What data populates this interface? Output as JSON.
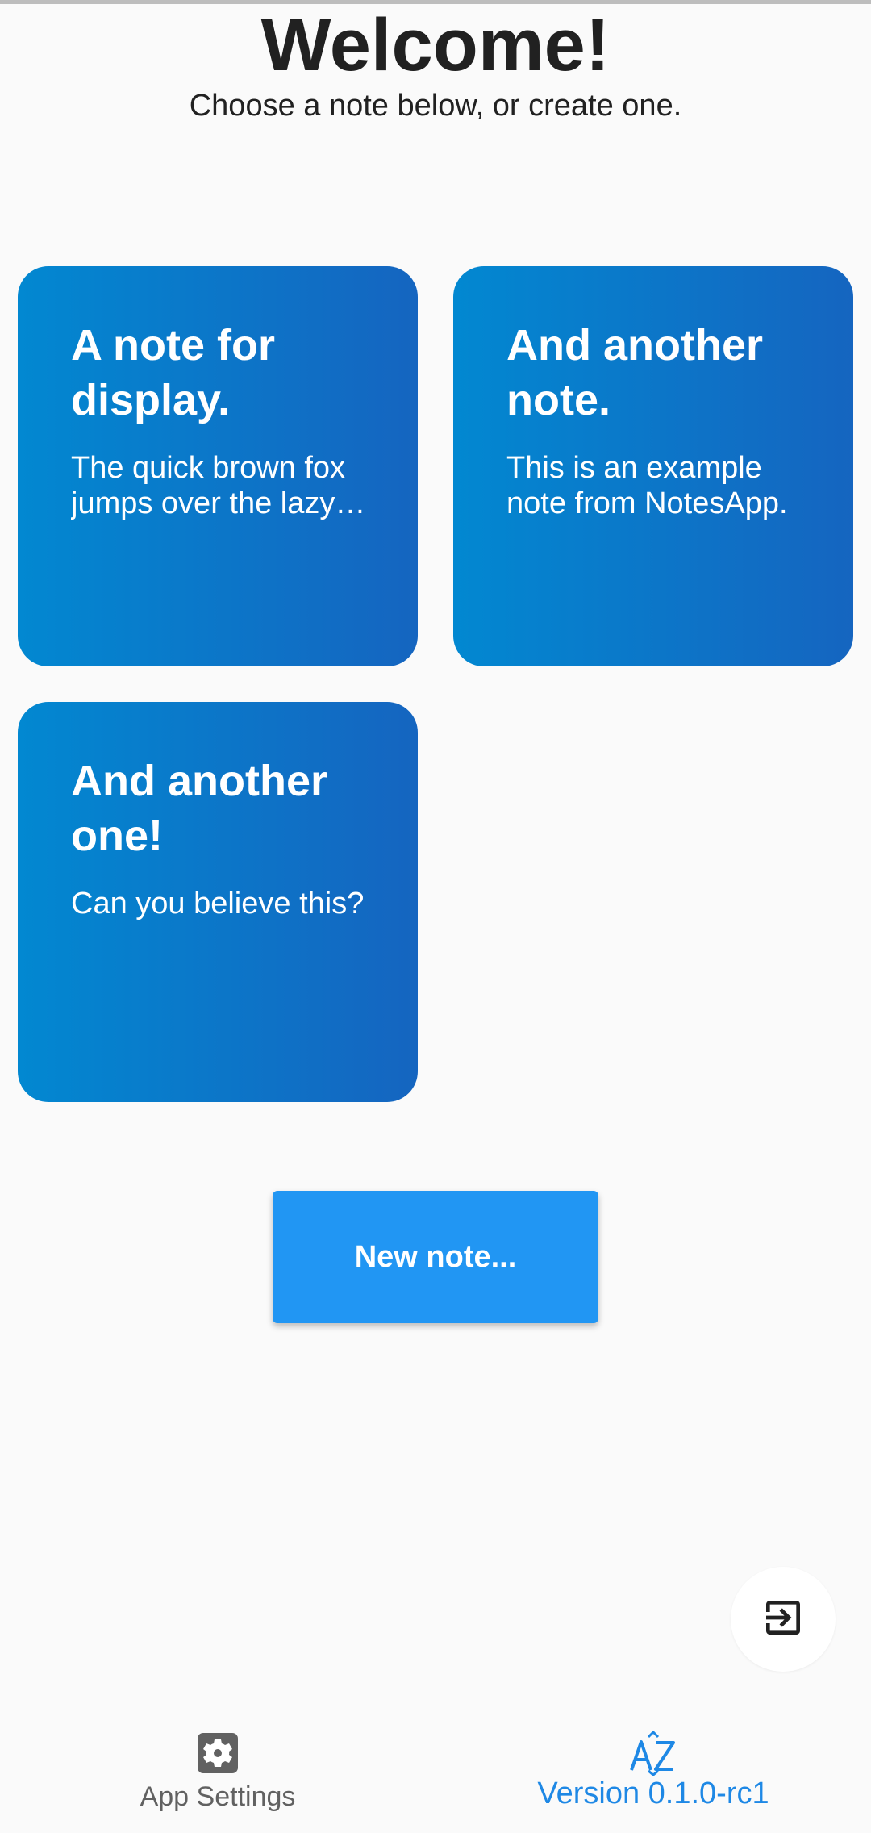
{
  "header": {
    "title": "Welcome!",
    "subtitle": "Choose a note below, or create one."
  },
  "notes": [
    {
      "title": "A note for display.",
      "body": "The quick brown fox jumps over the lazy dog."
    },
    {
      "title": "And another note.",
      "body": "This is an example note from NotesApp."
    },
    {
      "title": "And another one!",
      "body": "Can you believe this?"
    }
  ],
  "actions": {
    "new_note_label": "New note...",
    "exit_icon": "exit-to-app-icon"
  },
  "bottom_nav": {
    "items": [
      {
        "label": "App Settings",
        "icon": "gear-icon"
      },
      {
        "label": "Version 0.1.0-rc1",
        "icon": "sort-alphabetical-icon"
      }
    ]
  },
  "colors": {
    "background": "#fafafa",
    "card_gradient_start": "#0288d1",
    "card_gradient_end": "#1565c0",
    "primary_button": "#2196f3",
    "accent": "#1e88e5"
  }
}
